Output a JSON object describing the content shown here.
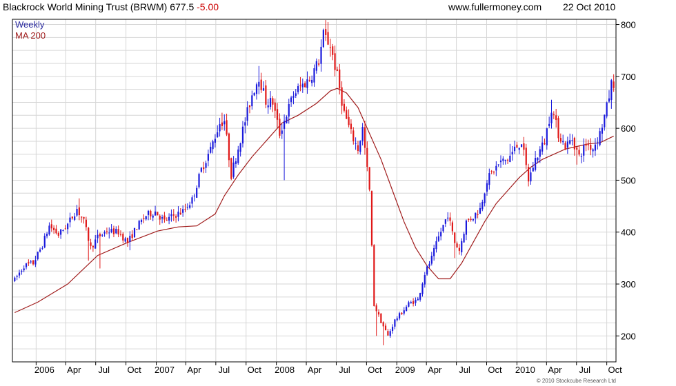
{
  "header": {
    "title": "Blackrock World Mining Trust (BRWM)",
    "price": "677.5",
    "change": "-5.00",
    "site": "www.fullermoney.com",
    "date": "22 Oct 2010"
  },
  "copyright": "© 2010 Stockcube Research Ltd",
  "colors": {
    "up": "#1a1adc",
    "down": "#e01818",
    "ma": "#a01c1c",
    "grid": "#d6d6d6",
    "axis": "#000000",
    "legend_weekly": "#2a2aa0",
    "legend_ma": "#a01c1c",
    "change": "#cc0000"
  },
  "chart_data": {
    "type": "candlestick",
    "interval_label": "Weekly",
    "ma_label": "MA 200",
    "ylim": [
      150,
      810
    ],
    "yticks": [
      200,
      300,
      400,
      500,
      600,
      700,
      800
    ],
    "x_range": [
      "2005-10-21",
      "2010-10-29"
    ],
    "grid": true,
    "legend_position": "top-left",
    "xticks": [
      {
        "label": "2006",
        "date": "2006-01-01"
      },
      {
        "label": "Apr",
        "date": "2006-04-01"
      },
      {
        "label": "Jul",
        "date": "2006-07-01"
      },
      {
        "label": "Oct",
        "date": "2006-10-01"
      },
      {
        "label": "2007",
        "date": "2007-01-01"
      },
      {
        "label": "Apr",
        "date": "2007-04-01"
      },
      {
        "label": "Jul",
        "date": "2007-07-01"
      },
      {
        "label": "Oct",
        "date": "2007-10-01"
      },
      {
        "label": "2008",
        "date": "2008-01-01"
      },
      {
        "label": "Apr",
        "date": "2008-04-01"
      },
      {
        "label": "Jul",
        "date": "2008-07-01"
      },
      {
        "label": "Oct",
        "date": "2008-10-01"
      },
      {
        "label": "2009",
        "date": "2009-01-01"
      },
      {
        "label": "Apr",
        "date": "2009-04-01"
      },
      {
        "label": "Jul",
        "date": "2009-07-01"
      },
      {
        "label": "Oct",
        "date": "2009-10-01"
      },
      {
        "label": "2010",
        "date": "2010-01-01"
      },
      {
        "label": "Apr",
        "date": "2010-04-01"
      },
      {
        "label": "Jul",
        "date": "2010-07-01"
      },
      {
        "label": "Oct",
        "date": "2010-10-01"
      }
    ],
    "price_path": [
      [
        "2005-10-28",
        308
      ],
      [
        "2005-11-25",
        335
      ],
      [
        "2005-12-23",
        340
      ],
      [
        "2006-01-20",
        375
      ],
      [
        "2006-02-10",
        412
      ],
      [
        "2006-03-10",
        395
      ],
      [
        "2006-04-07",
        415
      ],
      [
        "2006-05-05",
        445
      ],
      [
        "2006-05-26",
        420
      ],
      [
        "2006-06-16",
        370
      ],
      [
        "2006-07-07",
        390
      ],
      [
        "2006-08-04",
        402
      ],
      [
        "2006-09-08",
        400
      ],
      [
        "2006-10-06",
        380
      ],
      [
        "2006-11-03",
        410
      ],
      [
        "2006-12-01",
        432
      ],
      [
        "2006-12-29",
        440
      ],
      [
        "2007-01-26",
        420
      ],
      [
        "2007-02-23",
        432
      ],
      [
        "2007-03-23",
        440
      ],
      [
        "2007-04-20",
        462
      ],
      [
        "2007-05-18",
        520
      ],
      [
        "2007-06-15",
        560
      ],
      [
        "2007-07-13",
        610
      ],
      [
        "2007-07-27",
        615
      ],
      [
        "2007-08-17",
        510
      ],
      [
        "2007-09-14",
        580
      ],
      [
        "2007-10-19",
        665
      ],
      [
        "2007-11-09",
        700
      ],
      [
        "2007-11-30",
        652
      ],
      [
        "2007-12-21",
        650
      ],
      [
        "2008-01-11",
        590
      ],
      [
        "2008-01-25",
        615
      ],
      [
        "2008-02-22",
        665
      ],
      [
        "2008-03-14",
        680
      ],
      [
        "2008-04-11",
        695
      ],
      [
        "2008-05-09",
        730
      ],
      [
        "2008-05-23",
        780
      ],
      [
        "2008-06-13",
        760
      ],
      [
        "2008-07-04",
        700
      ],
      [
        "2008-07-25",
        630
      ],
      [
        "2008-08-15",
        590
      ],
      [
        "2008-09-05",
        560
      ],
      [
        "2008-09-19",
        600
      ],
      [
        "2008-10-10",
        480
      ],
      [
        "2008-10-24",
        260
      ],
      [
        "2008-11-14",
        228
      ],
      [
        "2008-12-05",
        200
      ],
      [
        "2008-12-26",
        230
      ],
      [
        "2009-01-16",
        245
      ],
      [
        "2009-02-06",
        262
      ],
      [
        "2009-03-06",
        270
      ],
      [
        "2009-03-27",
        320
      ],
      [
        "2009-04-17",
        350
      ],
      [
        "2009-05-08",
        390
      ],
      [
        "2009-06-05",
        435
      ],
      [
        "2009-06-26",
        380
      ],
      [
        "2009-07-10",
        365
      ],
      [
        "2009-07-31",
        420
      ],
      [
        "2009-08-21",
        430
      ],
      [
        "2009-09-11",
        445
      ],
      [
        "2009-10-02",
        500
      ],
      [
        "2009-10-23",
        520
      ],
      [
        "2009-11-13",
        535
      ],
      [
        "2009-12-04",
        540
      ],
      [
        "2009-12-25",
        560
      ],
      [
        "2010-01-15",
        575
      ],
      [
        "2010-02-05",
        500
      ],
      [
        "2010-02-26",
        540
      ],
      [
        "2010-03-26",
        575
      ],
      [
        "2010-04-16",
        640
      ],
      [
        "2010-05-07",
        590
      ],
      [
        "2010-05-28",
        565
      ],
      [
        "2010-06-18",
        580
      ],
      [
        "2010-07-09",
        545
      ],
      [
        "2010-07-30",
        570
      ],
      [
        "2010-08-20",
        562
      ],
      [
        "2010-09-10",
        590
      ],
      [
        "2010-10-01",
        640
      ],
      [
        "2010-10-15",
        685
      ],
      [
        "2010-10-22",
        677.5
      ]
    ],
    "ma200": [
      [
        "2005-10-28",
        245
      ],
      [
        "2006-01-06",
        265
      ],
      [
        "2006-04-07",
        300
      ],
      [
        "2006-07-07",
        355
      ],
      [
        "2006-10-06",
        380
      ],
      [
        "2007-01-05",
        402
      ],
      [
        "2007-03-09",
        410
      ],
      [
        "2007-05-04",
        412
      ],
      [
        "2007-06-29",
        435
      ],
      [
        "2007-07-27",
        470
      ],
      [
        "2007-09-07",
        510
      ],
      [
        "2007-10-19",
        545
      ],
      [
        "2007-12-07",
        580
      ],
      [
        "2008-01-18",
        610
      ],
      [
        "2008-03-07",
        625
      ],
      [
        "2008-05-02",
        648
      ],
      [
        "2008-06-13",
        672
      ],
      [
        "2008-07-04",
        677
      ],
      [
        "2008-08-01",
        668
      ],
      [
        "2008-09-05",
        640
      ],
      [
        "2008-10-10",
        590
      ],
      [
        "2008-11-14",
        540
      ],
      [
        "2008-12-19",
        480
      ],
      [
        "2009-01-23",
        420
      ],
      [
        "2009-02-27",
        370
      ],
      [
        "2009-04-03",
        335
      ],
      [
        "2009-05-08",
        310
      ],
      [
        "2009-06-12",
        310
      ],
      [
        "2009-07-17",
        340
      ],
      [
        "2009-08-21",
        380
      ],
      [
        "2009-09-25",
        420
      ],
      [
        "2009-10-30",
        455
      ],
      [
        "2009-12-04",
        480
      ],
      [
        "2010-01-08",
        505
      ],
      [
        "2010-02-12",
        525
      ],
      [
        "2010-03-19",
        540
      ],
      [
        "2010-04-23",
        550
      ],
      [
        "2010-05-28",
        560
      ],
      [
        "2010-07-02",
        565
      ],
      [
        "2010-08-06",
        570
      ],
      [
        "2010-09-10",
        572
      ],
      [
        "2010-10-22",
        585
      ]
    ],
    "lows": [
      [
        "2006-06-09",
        345
      ],
      [
        "2006-07-14",
        330
      ],
      [
        "2006-10-13",
        365
      ],
      [
        "2007-02-02",
        422
      ],
      [
        "2007-08-17",
        500
      ],
      [
        "2008-01-25",
        500
      ],
      [
        "2008-10-31",
        200
      ],
      [
        "2008-11-21",
        182
      ],
      [
        "2009-06-26",
        350
      ],
      [
        "2010-02-05",
        488
      ],
      [
        "2010-07-02",
        530
      ]
    ],
    "highs": [
      [
        "2006-05-12",
        465
      ],
      [
        "2007-07-20",
        630
      ],
      [
        "2007-11-09",
        720
      ],
      [
        "2008-05-23",
        792
      ],
      [
        "2009-12-11",
        570
      ],
      [
        "2010-04-16",
        655
      ],
      [
        "2010-10-15",
        695
      ]
    ]
  }
}
